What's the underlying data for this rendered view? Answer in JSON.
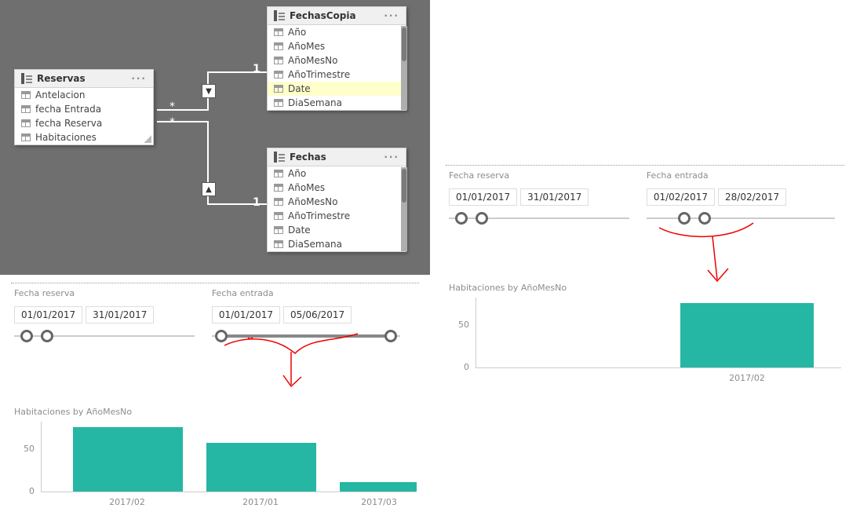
{
  "diagram": {
    "tables": {
      "reservas": {
        "title": "Reservas",
        "fields": [
          "Antelacion",
          "fecha Entrada",
          "fecha Reserva",
          "Habitaciones"
        ]
      },
      "fechascopia": {
        "title": "FechasCopia",
        "fields": [
          "Año",
          "AñoMes",
          "AñoMesNo",
          "AñoTrimestre",
          "Date",
          "DiaSemana"
        ]
      },
      "fechas": {
        "title": "Fechas",
        "fields": [
          "Año",
          "AñoMes",
          "AñoMesNo",
          "AñoTrimestre",
          "Date",
          "DiaSemana"
        ]
      }
    },
    "cardinality": {
      "many": "*",
      "one": "1"
    }
  },
  "left": {
    "slicer_reserva": {
      "label": "Fecha reserva",
      "from": "01/01/2017",
      "to": "31/01/2017"
    },
    "slicer_entrada": {
      "label": "Fecha entrada",
      "from": "01/01/2017",
      "to": "05/06/2017"
    },
    "chart": {
      "title": "Habitaciones by AñoMesNo"
    }
  },
  "right": {
    "slicer_reserva": {
      "label": "Fecha reserva",
      "from": "01/01/2017",
      "to": "31/01/2017"
    },
    "slicer_entrada": {
      "label": "Fecha entrada",
      "from": "01/02/2017",
      "to": "28/02/2017"
    },
    "chart": {
      "title": "Habitaciones by AñoMesNo"
    }
  },
  "axis": {
    "y50": "50",
    "y0": "0"
  },
  "chart_data": [
    {
      "type": "bar",
      "title": "Habitaciones by AñoMesNo",
      "xlabel": "AñoMesNo",
      "ylabel": "Habitaciones",
      "ylim": [
        0,
        80
      ],
      "categories": [
        "2017/02",
        "2017/01",
        "2017/03"
      ],
      "values": [
        73,
        55,
        10
      ]
    },
    {
      "type": "bar",
      "title": "Habitaciones by AñoMesNo",
      "xlabel": "AñoMesNo",
      "ylabel": "Habitaciones",
      "ylim": [
        0,
        80
      ],
      "categories": [
        "2017/02"
      ],
      "values": [
        73
      ]
    }
  ]
}
